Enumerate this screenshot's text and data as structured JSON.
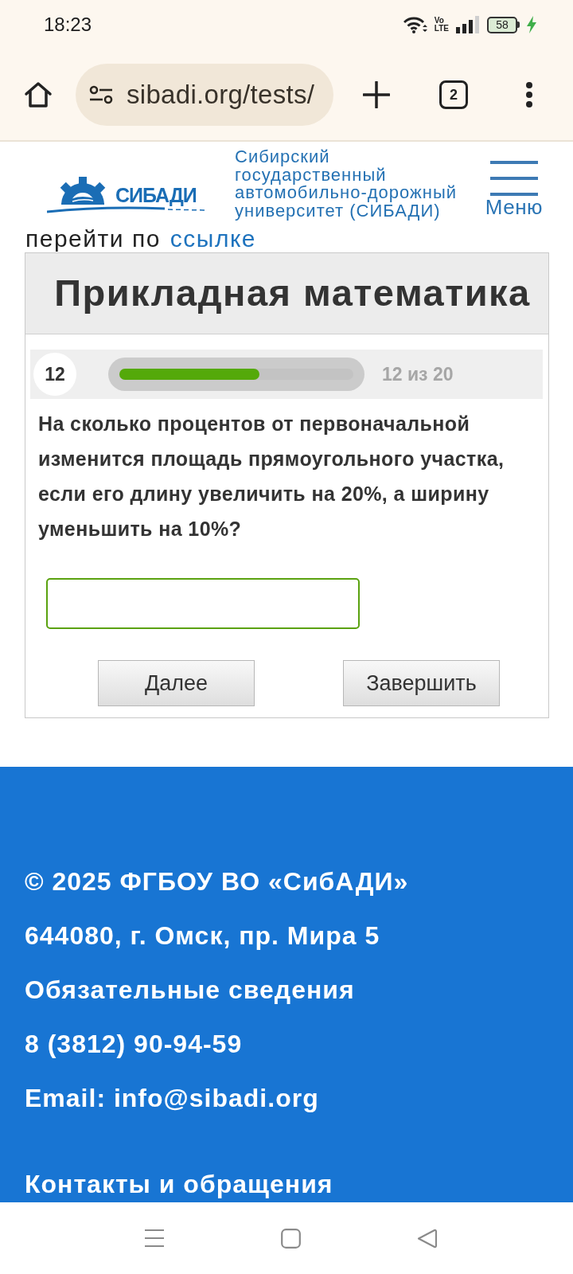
{
  "status_bar": {
    "time": "18:23",
    "network_type": [
      "Vo",
      "LTE"
    ],
    "battery": "58",
    "charging": true
  },
  "browser_bar": {
    "url": "sibadi.org/tests/",
    "tab_count": "2"
  },
  "site_header": {
    "logo_text": "СИБАДИ",
    "university_name": "Сибирский государственный автомобильно-дорожный университет (СИБАДИ)",
    "menu_label": "Меню"
  },
  "partial_line": {
    "text": "перейти по",
    "link": "ссылке"
  },
  "test": {
    "title": "Прикладная математика",
    "question_number": "12",
    "level": 0.6,
    "progress_label": "12 из 20",
    "question": "На сколько процентов от первоначальной изменится площадь прямоугольного участка, если его длину увеличить на 20%, а ширину уменьшить на 10%?",
    "buttons": [
      {
        "label": "Далее"
      },
      {
        "label": "Завершить"
      }
    ]
  },
  "footer": {
    "items": [
      "© 2025 ФГБОУ ВО «СибАДИ»",
      "644080, г. Омск, пр. Мира 5",
      "Обязательные сведения",
      "8 (3812) 90-94-59",
      "Email: info@sibadi.org",
      "Контакты и обращения"
    ]
  }
}
